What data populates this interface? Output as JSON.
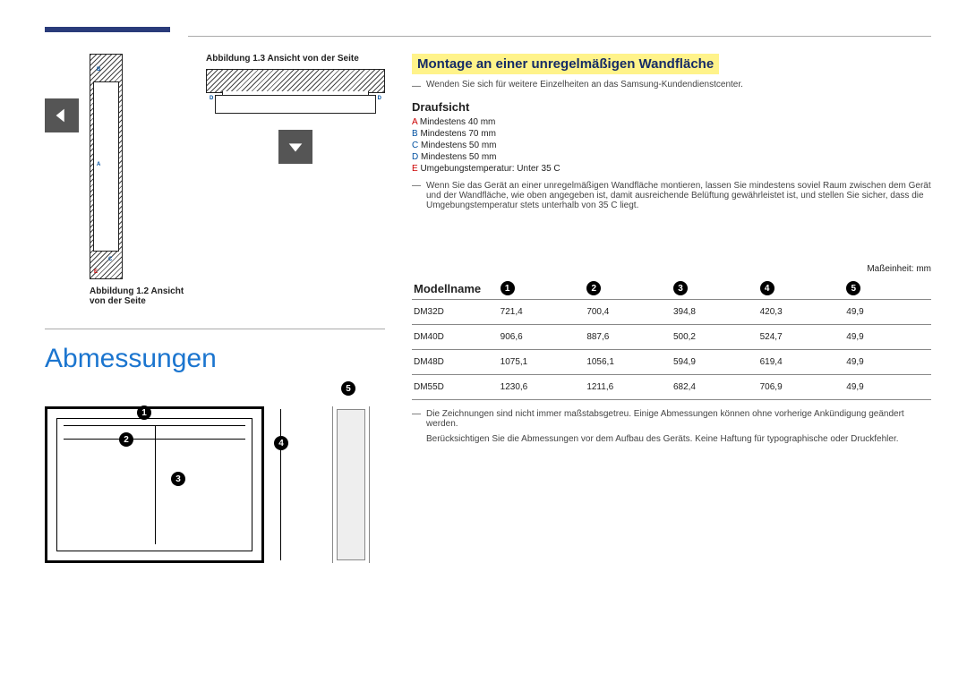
{
  "figure3_caption": "Abbildung 1.3 Ansicht von der Seite",
  "figure2_caption": "Abbildung 1.2 Ansicht von der Seite",
  "side_labels": {
    "B": "B",
    "A": "A",
    "C": "C",
    "E": "E",
    "D": "D"
  },
  "section_title": "Abmessungen",
  "dim_fig_numbers": {
    "n1": "1",
    "n2": "2",
    "n3": "3",
    "n4": "4",
    "n5": "5"
  },
  "mount_heading": "Montage an einer unregelmäßigen Wandfläche",
  "mount_note": "Wenden Sie sich für weitere Einzelheiten an das Samsung-Kundendienstcenter.",
  "topview_heading": "Draufsicht",
  "specs": {
    "a": {
      "k": "A",
      "v": "Mindestens 40 mm"
    },
    "b": {
      "k": "B",
      "v": "Mindestens 70 mm"
    },
    "c": {
      "k": "C",
      "v": "Mindestens 50 mm"
    },
    "d": {
      "k": "D",
      "v": "Mindestens 50 mm"
    },
    "e": {
      "k": "E",
      "v": "Umgebungstemperatur: Unter 35 C"
    }
  },
  "mount_body": "Wenn Sie das Gerät an einer unregelmäßigen Wandfläche montieren, lassen Sie mindestens soviel Raum zwischen dem Gerät und der Wandfläche, wie oben angegeben ist, damit ausreichende Belüftung gewährleistet ist, und stellen Sie sicher, dass die Umgebungstemperatur stets unterhalb von 35 C liegt.",
  "unit_label": "Maßeinheit: mm",
  "table": {
    "model_header": "Modellname",
    "cols": [
      "1",
      "2",
      "3",
      "4",
      "5"
    ],
    "rows": [
      {
        "model": "DM32D",
        "v": [
          "721,4",
          "700,4",
          "394,8",
          "420,3",
          "49,9"
        ]
      },
      {
        "model": "DM40D",
        "v": [
          "906,6",
          "887,6",
          "500,2",
          "524,7",
          "49,9"
        ]
      },
      {
        "model": "DM48D",
        "v": [
          "1075,1",
          "1056,1",
          "594,9",
          "619,4",
          "49,9"
        ]
      },
      {
        "model": "DM55D",
        "v": [
          "1230,6",
          "1211,6",
          "682,4",
          "706,9",
          "49,9"
        ]
      }
    ]
  },
  "footnote1": "Die Zeichnungen sind nicht immer maßstabsgetreu. Einige Abmessungen können ohne vorherige Ankündigung geändert werden.",
  "footnote2": "Berücksichtigen Sie die Abmessungen vor dem Aufbau des Geräts. Keine Haftung für typographische oder Druckfehler."
}
